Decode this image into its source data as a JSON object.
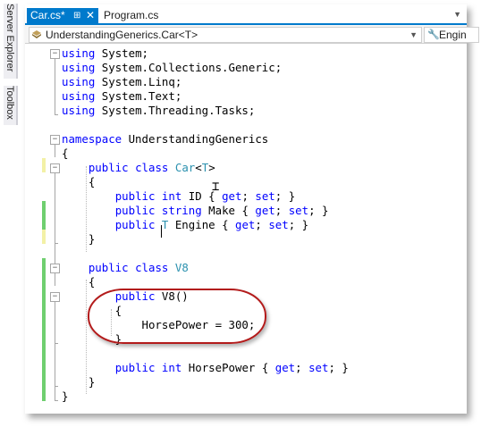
{
  "side_panel": {
    "tabs": [
      "Server Explorer",
      "Toolbox"
    ]
  },
  "editor_tabs": [
    {
      "label": "Car.cs*",
      "active": true
    },
    {
      "label": "Program.cs",
      "active": false
    }
  ],
  "navbar": {
    "type_selector": "UnderstandingGenerics.Car<T>",
    "member_selector": "Engin"
  },
  "code_lines": [
    "using System;",
    "using System.Collections.Generic;",
    "using System.Linq;",
    "using System.Text;",
    "using System.Threading.Tasks;",
    "",
    "namespace UnderstandingGenerics",
    "{",
    "    public class Car<T>",
    "    {",
    "        public int ID { get; set; }",
    "        public string Make { get; set; }",
    "        public T Engine { get; set; }",
    "    }",
    "",
    "    public class V8",
    "    {",
    "        public V8()",
    "        {",
    "            HorsePower = 300;",
    "        }",
    "",
    "        public int HorsePower { get; set; }",
    "    }",
    "}"
  ],
  "colors": {
    "accent": "#007acc",
    "keyword": "#0000ff",
    "type": "#2b91af",
    "highlight": "#b31b1b",
    "change_saved": "#6fcf6f",
    "change_unsaved": "#f3f1a6"
  }
}
